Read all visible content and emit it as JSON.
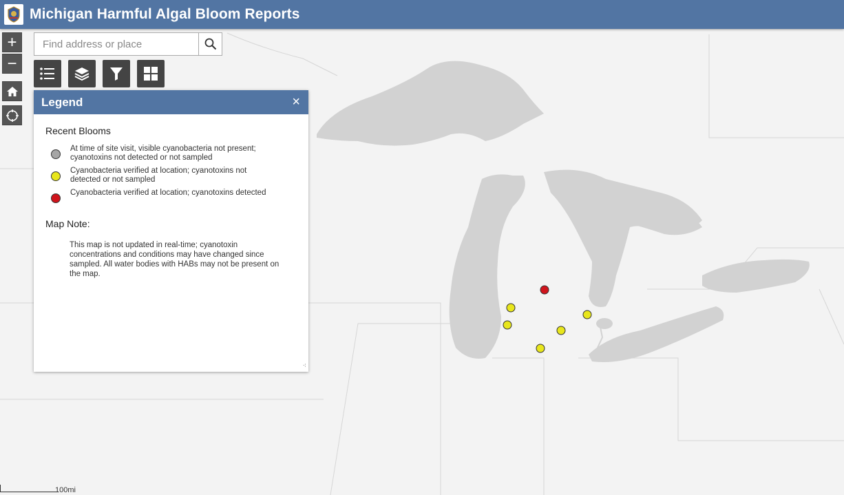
{
  "app": {
    "title": "Michigan Harmful Algal Bloom Reports"
  },
  "search": {
    "placeholder": "Find address or place"
  },
  "nav": {
    "zoom_in": "+",
    "zoom_out": "−"
  },
  "toolbar": {
    "items": [
      "legend-icon",
      "layers-icon",
      "filter-icon",
      "basemap-gallery-icon"
    ]
  },
  "legend": {
    "title": "Legend",
    "close": "×",
    "section_title": "Recent Blooms",
    "items": [
      {
        "label": "At time of site visit, visible cyanobacteria not present; cyanotoxins not detected or not sampled",
        "color": "#a6a6a6"
      },
      {
        "label": "Cyanobacteria verified at location; cyanotoxins not detected or not sampled",
        "color": "#e8e61c"
      },
      {
        "label": "Cyanobacteria verified at location; cyanotoxins detected",
        "color": "#d0141c"
      }
    ],
    "note_title": "Map Note:",
    "note_text": "This map is not updated in real-time; cyanotoxin concentrations and conditions may have changed since sampled. All water bodies with HABs may not be present on the map."
  },
  "map": {
    "colors": {
      "land": "#f3f3f3",
      "water": "#d2d2d2",
      "border": "#d6d6d6"
    },
    "points": [
      {
        "status": "cyanotoxins detected",
        "color": "#d0141c"
      },
      {
        "status": "cyanobacteria verified",
        "color": "#e8e61c"
      },
      {
        "status": "cyanobacteria verified",
        "color": "#e8e61c"
      },
      {
        "status": "cyanobacteria verified",
        "color": "#e8e61c"
      },
      {
        "status": "cyanobacteria verified",
        "color": "#e8e61c"
      },
      {
        "status": "cyanobacteria verified",
        "color": "#e8e61c"
      }
    ]
  },
  "scale": {
    "label": "100mi"
  }
}
